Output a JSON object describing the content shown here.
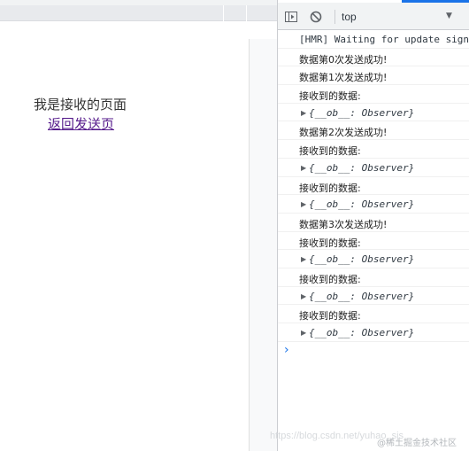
{
  "page": {
    "title": "我是接收的页面",
    "link": "返回发送页"
  },
  "devtools": {
    "toolbar": {
      "context": "top",
      "dropdown_glyph": "▼",
      "icons": [
        "sidebar-toggle-icon",
        "clear-console-icon"
      ]
    },
    "console": {
      "lines": [
        {
          "kind": "text",
          "mono": true,
          "text": "[HMR] Waiting for update signal from WDS..."
        },
        {
          "kind": "text",
          "text": "数据第0次发送成功!"
        },
        {
          "kind": "text",
          "text": "数据第1次发送成功!"
        },
        {
          "kind": "text",
          "text": "接收到的数据:"
        },
        {
          "kind": "object",
          "text": "{__ob__: Observer}"
        },
        {
          "kind": "text",
          "text": "数据第2次发送成功!"
        },
        {
          "kind": "text",
          "text": "接收到的数据:"
        },
        {
          "kind": "object",
          "text": "{__ob__: Observer}"
        },
        {
          "kind": "text",
          "text": "接收到的数据:"
        },
        {
          "kind": "object",
          "text": "{__ob__: Observer}"
        },
        {
          "kind": "text",
          "text": "数据第3次发送成功!"
        },
        {
          "kind": "text",
          "text": "接收到的数据:"
        },
        {
          "kind": "object",
          "text": "{__ob__: Observer}"
        },
        {
          "kind": "text",
          "text": "接收到的数据:"
        },
        {
          "kind": "object",
          "text": "{__ob__: Observer}"
        },
        {
          "kind": "text",
          "text": "接收到的数据:"
        },
        {
          "kind": "object",
          "text": "{__ob__: Observer}"
        }
      ],
      "prompt": "›"
    }
  },
  "watermarks": {
    "url": "https://blog.csdn.net/yuhao_sjs",
    "site": "@稀土掘金技术社区"
  },
  "colors": {
    "accent": "#1a73e8",
    "visited_link": "#551a8b"
  }
}
